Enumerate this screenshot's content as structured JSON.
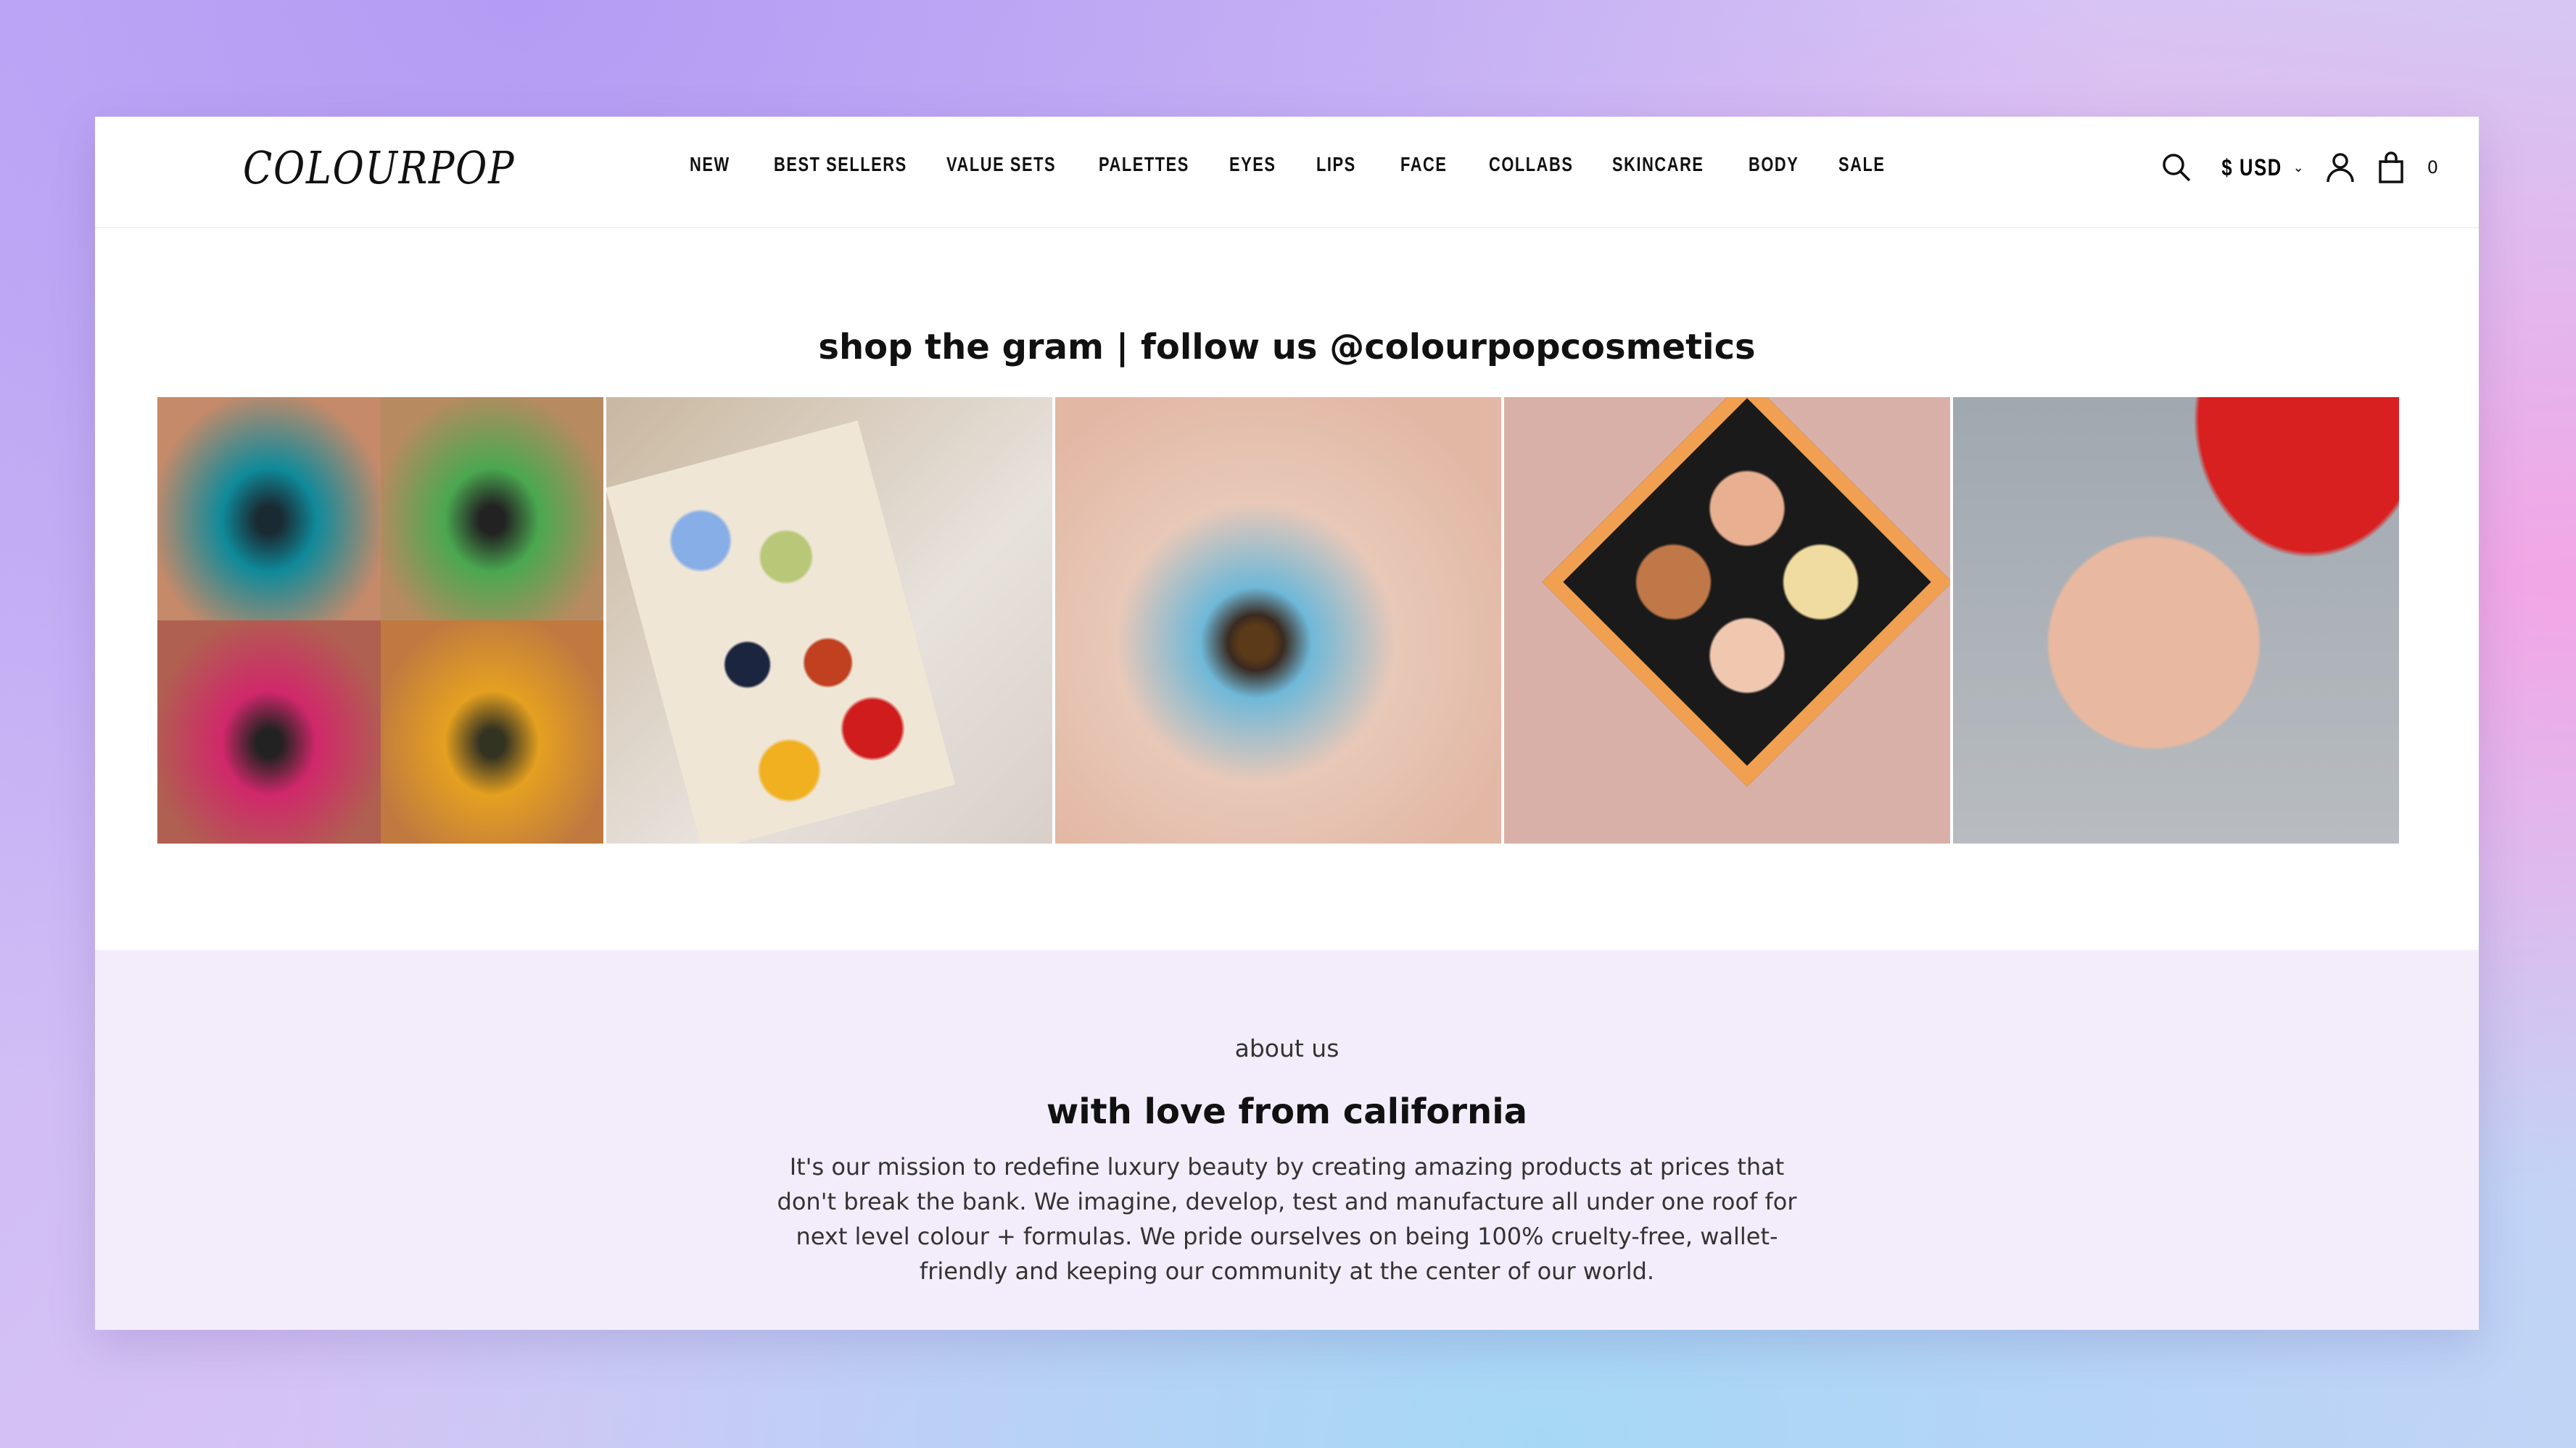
{
  "header": {
    "logo": "COLOURPOP",
    "nav": [
      "NEW",
      "BEST SELLERS",
      "VALUE SETS",
      "PALETTES",
      "EYES",
      "LIPS",
      "FACE",
      "COLLABS",
      "SKINCARE",
      "BODY",
      "SALE"
    ],
    "currency": "$ USD",
    "cart_count": "0"
  },
  "gram": {
    "title": "shop the gram | follow us @colourpopcosmetics",
    "tiles": [
      "eyeshadow-looks-collage",
      "palette-flatlay",
      "blue-eyeliner-look",
      "highlighter-palette",
      "red-beret-makeup-look"
    ]
  },
  "about": {
    "eyebrow": "about us",
    "title": "with love from california",
    "body": "It's our mission to redefine luxury beauty by creating amazing products at prices that don't break the bank. We imagine, develop, test and manufacture all under one roof for next level colour + formulas. We pride ourselves on being 100% cruelty-free, wallet-friendly and keeping our community at the center of our world."
  }
}
